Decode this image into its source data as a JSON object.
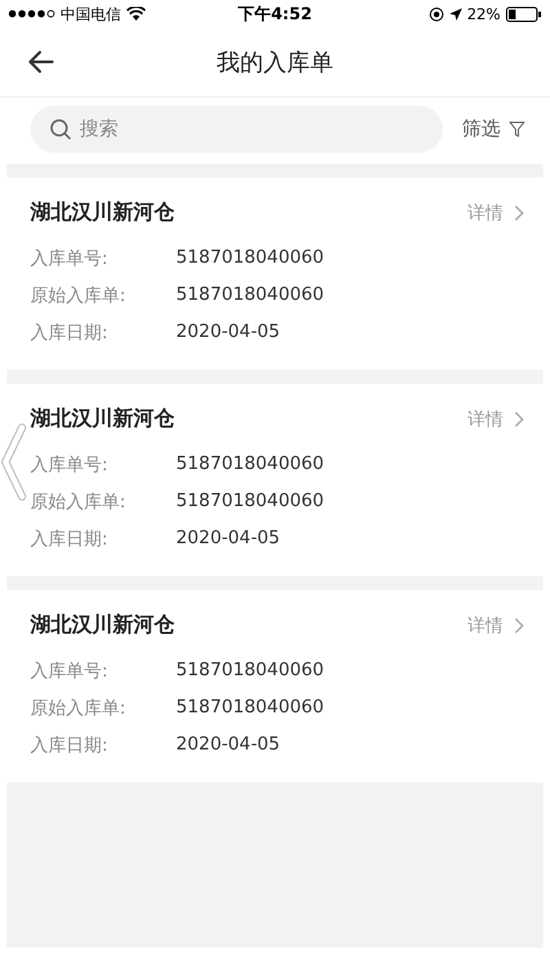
{
  "status_bar": {
    "carrier": "中国电信",
    "time": "下午4:52",
    "battery": "22%"
  },
  "nav": {
    "title": "我的入库单"
  },
  "search": {
    "placeholder": "搜索",
    "filter_label": "筛选"
  },
  "orders": [
    {
      "warehouse": "湖北汉川新河仓",
      "detail_label": "详情",
      "fields": [
        {
          "label": "入库单号:",
          "value": "5187018040060"
        },
        {
          "label": "原始入库单:",
          "value": "5187018040060"
        },
        {
          "label": "入库日期:",
          "value": "2020-04-05"
        }
      ]
    },
    {
      "warehouse": "湖北汉川新河仓",
      "detail_label": "详情",
      "fields": [
        {
          "label": "入库单号:",
          "value": "5187018040060"
        },
        {
          "label": "原始入库单:",
          "value": "5187018040060"
        },
        {
          "label": "入库日期:",
          "value": "2020-04-05"
        }
      ]
    },
    {
      "warehouse": "湖北汉川新河仓",
      "detail_label": "详情",
      "fields": [
        {
          "label": "入库单号:",
          "value": "5187018040060"
        },
        {
          "label": "原始入库单:",
          "value": "5187018040060"
        },
        {
          "label": "入库日期:",
          "value": "2020-04-05"
        }
      ]
    }
  ]
}
